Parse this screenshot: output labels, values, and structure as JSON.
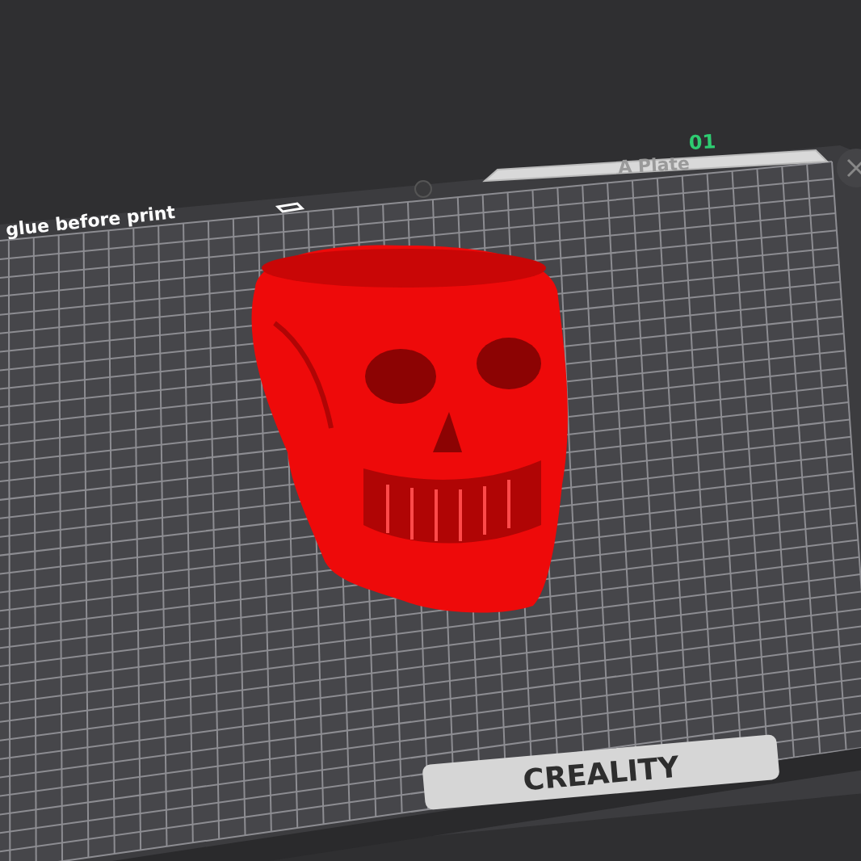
{
  "viewport": {
    "plate_hint": "glue before print",
    "plate_number": "01",
    "plate_name": "A Plate",
    "bed_logo": "CREALITY"
  }
}
